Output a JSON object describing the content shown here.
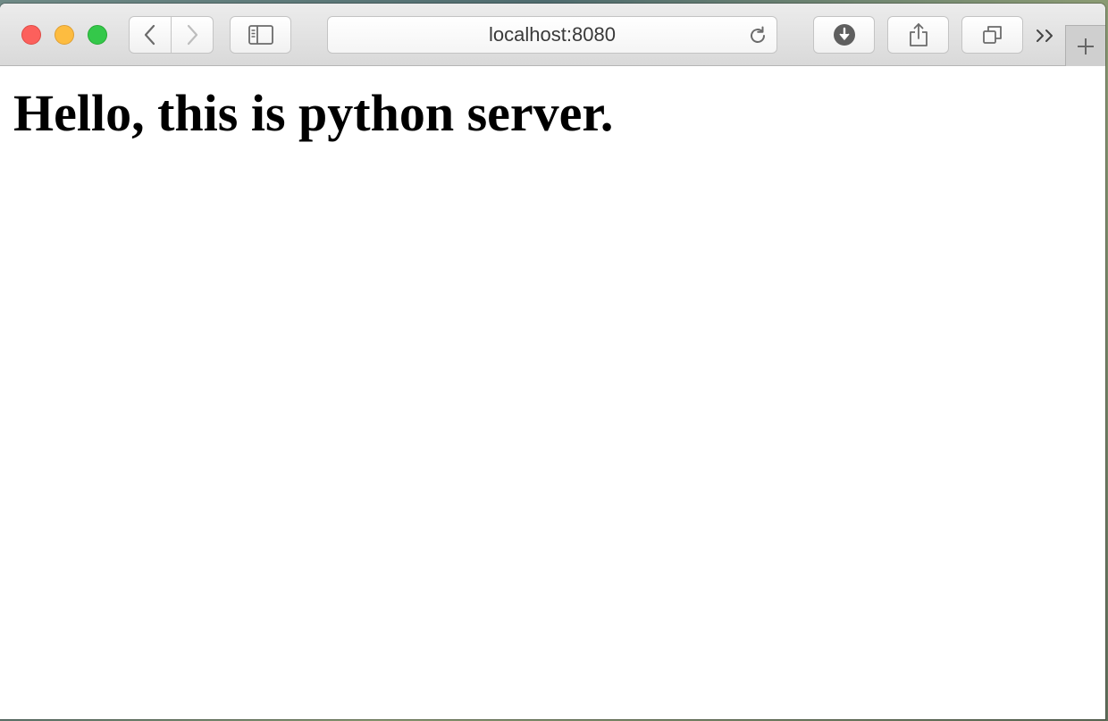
{
  "browser": {
    "address_bar": {
      "url": "localhost:8080"
    },
    "icons": {
      "back": "chevron-left-icon",
      "forward": "chevron-right-icon",
      "sidebar": "sidebar-icon",
      "reload": "reload-icon",
      "download": "download-icon",
      "share": "share-icon",
      "tabs": "tabs-overview-icon",
      "more": "double-chevron-right-icon",
      "new_tab": "plus-icon"
    },
    "colors": {
      "close": "#fc605c",
      "minimize": "#fdbc40",
      "maximize": "#34c84a"
    }
  },
  "page": {
    "heading": "Hello, this is python server."
  }
}
